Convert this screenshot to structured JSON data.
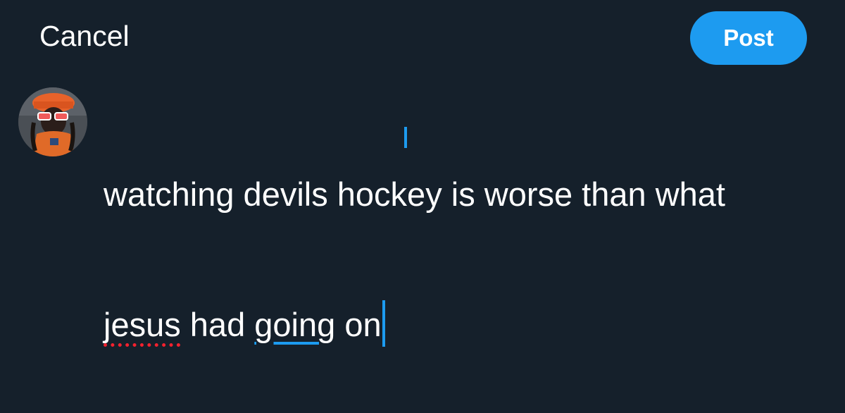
{
  "header": {
    "cancel_label": "Cancel",
    "post_label": "Post"
  },
  "composer": {
    "line1": "watching devils hockey is worse than what",
    "line2_word1": "jesus",
    "line2_space1": " had ",
    "line2_word2": "going",
    "line2_space2": " on"
  },
  "colors": {
    "background": "#15202b",
    "accent": "#1d9bf0",
    "spellcheck": "#f4212e"
  },
  "icons": {
    "avatar": "user-avatar"
  }
}
